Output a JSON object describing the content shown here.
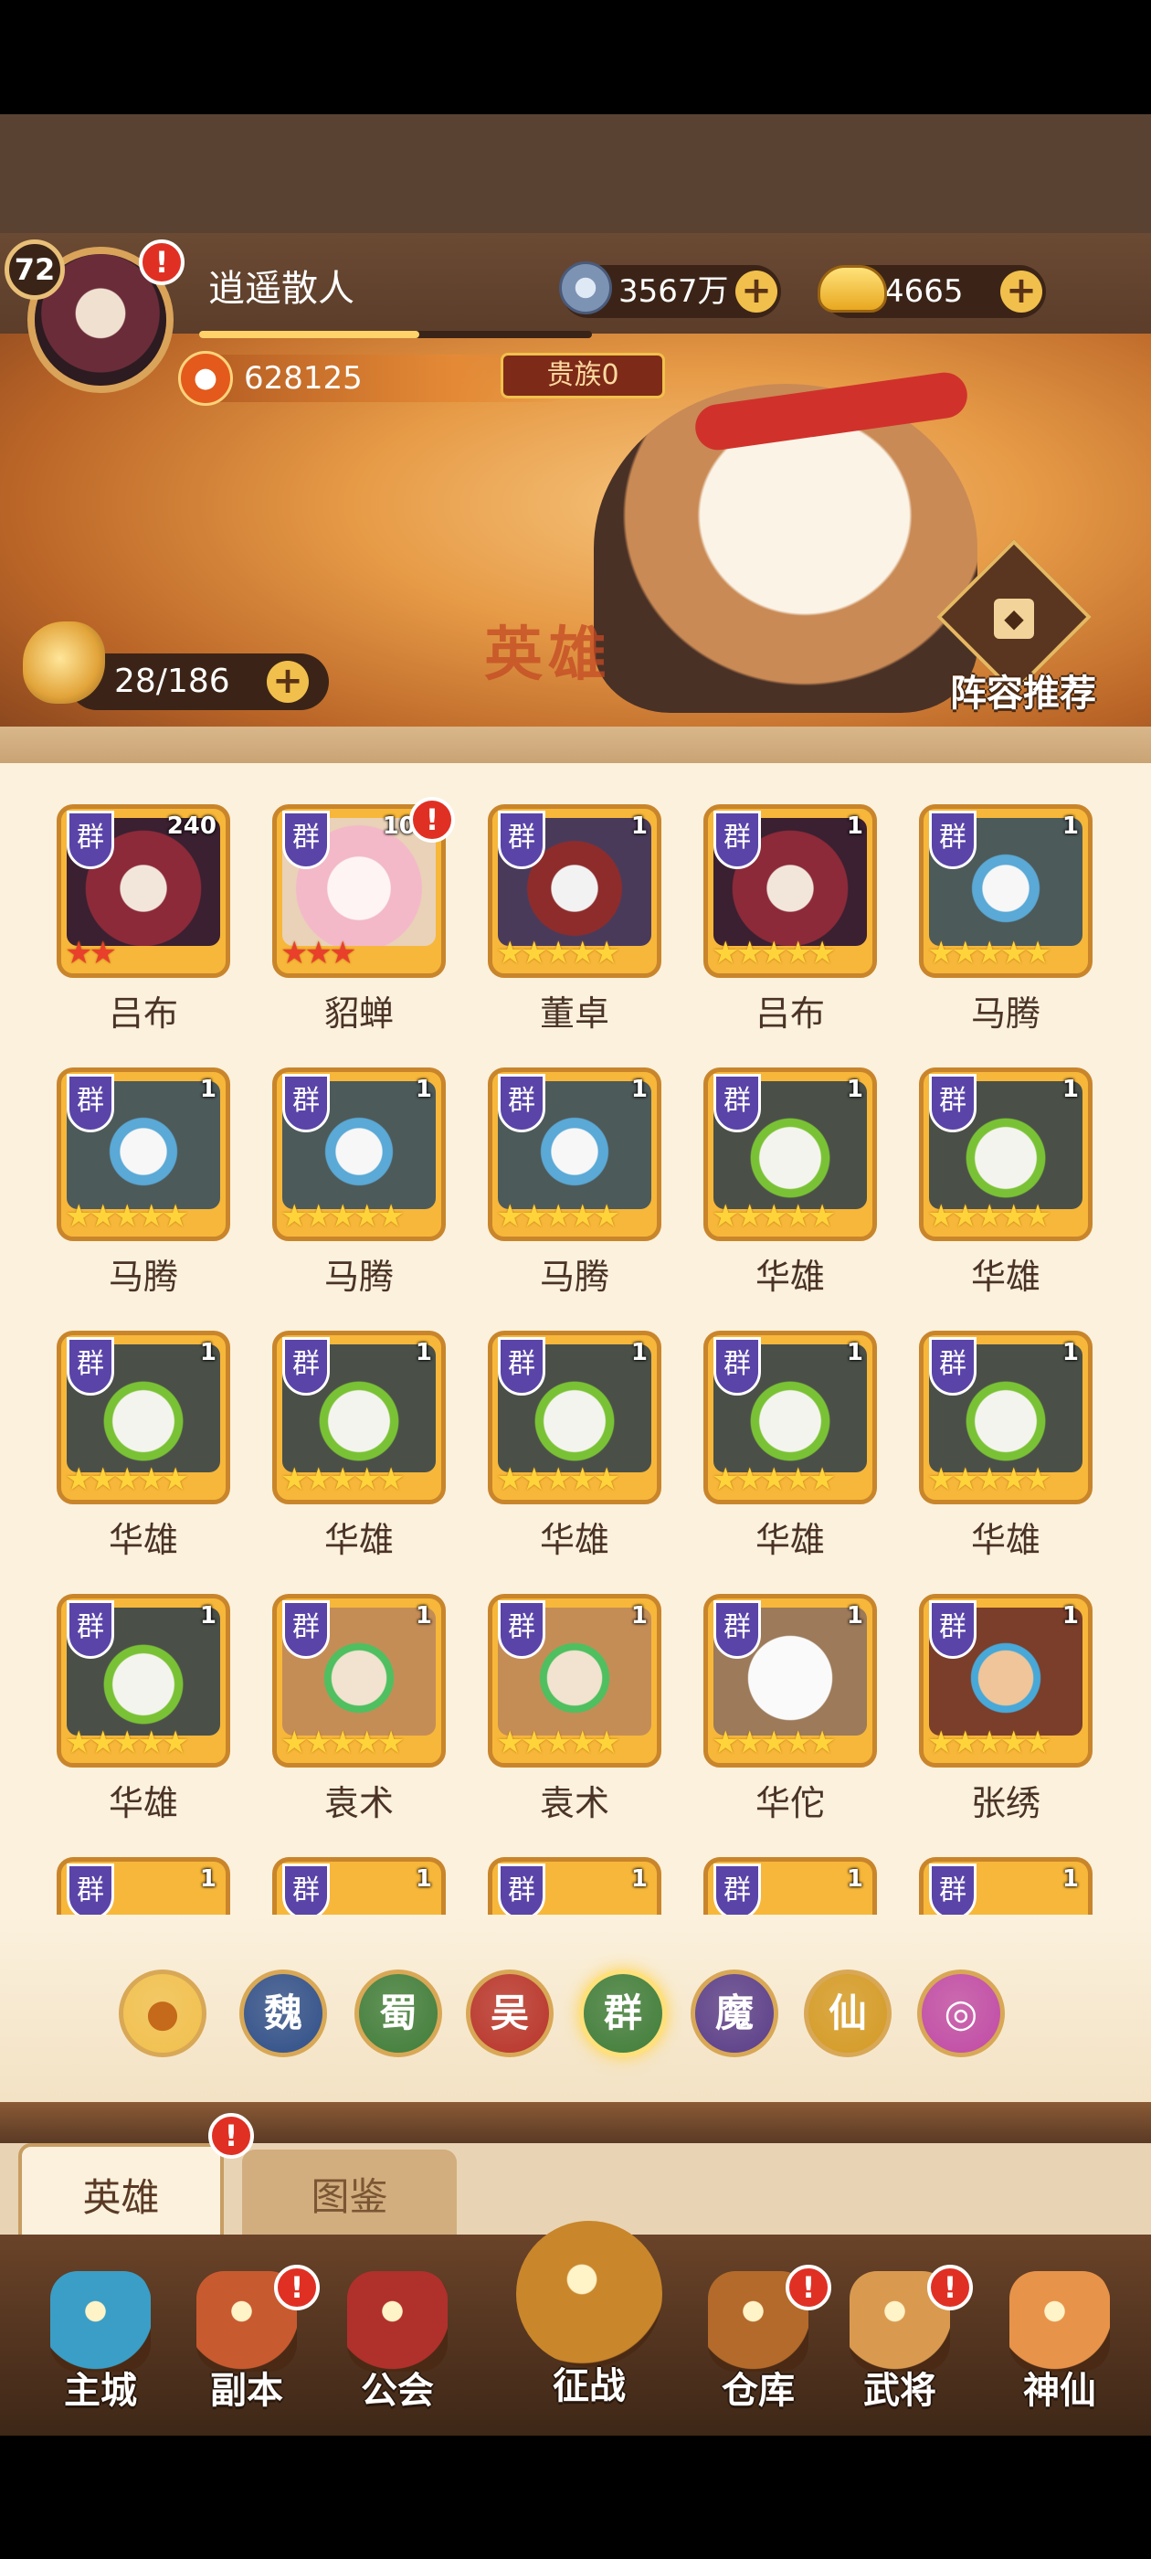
{
  "player": {
    "level": "72",
    "name": "逍遥散人",
    "exp_progress": 0.56,
    "power": "628125",
    "noble": "贵族0"
  },
  "currency": {
    "coins": "3567万",
    "ingots": "4665"
  },
  "banner": {
    "art_text": "英雄",
    "hero_count": "28/186",
    "lineup_label": "阵容推荐"
  },
  "heroes": [
    {
      "name": "吕布",
      "count": "240",
      "faction": "群",
      "stars": 2,
      "star_color": "red",
      "alert": false
    },
    {
      "name": "貂蝉",
      "count": "107",
      "faction": "群",
      "stars": 3,
      "star_color": "red",
      "alert": true
    },
    {
      "name": "董卓",
      "count": "1",
      "faction": "群",
      "stars": 5,
      "star_color": "gold",
      "alert": false
    },
    {
      "name": "吕布",
      "count": "1",
      "faction": "群",
      "stars": 5,
      "star_color": "gold",
      "alert": false
    },
    {
      "name": "马腾",
      "count": "1",
      "faction": "群",
      "stars": 5,
      "star_color": "gold",
      "alert": false
    },
    {
      "name": "马腾",
      "count": "1",
      "faction": "群",
      "stars": 5,
      "star_color": "gold",
      "alert": false
    },
    {
      "name": "马腾",
      "count": "1",
      "faction": "群",
      "stars": 5,
      "star_color": "gold",
      "alert": false
    },
    {
      "name": "马腾",
      "count": "1",
      "faction": "群",
      "stars": 5,
      "star_color": "gold",
      "alert": false
    },
    {
      "name": "华雄",
      "count": "1",
      "faction": "群",
      "stars": 5,
      "star_color": "gold",
      "alert": false
    },
    {
      "name": "华雄",
      "count": "1",
      "faction": "群",
      "stars": 5,
      "star_color": "gold",
      "alert": false
    },
    {
      "name": "华雄",
      "count": "1",
      "faction": "群",
      "stars": 5,
      "star_color": "gold",
      "alert": false
    },
    {
      "name": "华雄",
      "count": "1",
      "faction": "群",
      "stars": 5,
      "star_color": "gold",
      "alert": false
    },
    {
      "name": "华雄",
      "count": "1",
      "faction": "群",
      "stars": 5,
      "star_color": "gold",
      "alert": false
    },
    {
      "name": "华雄",
      "count": "1",
      "faction": "群",
      "stars": 5,
      "star_color": "gold",
      "alert": false
    },
    {
      "name": "华雄",
      "count": "1",
      "faction": "群",
      "stars": 5,
      "star_color": "gold",
      "alert": false
    },
    {
      "name": "华雄",
      "count": "1",
      "faction": "群",
      "stars": 5,
      "star_color": "gold",
      "alert": false
    },
    {
      "name": "袁术",
      "count": "1",
      "faction": "群",
      "stars": 5,
      "star_color": "gold",
      "alert": false
    },
    {
      "name": "袁术",
      "count": "1",
      "faction": "群",
      "stars": 5,
      "star_color": "gold",
      "alert": false
    },
    {
      "name": "华佗",
      "count": "1",
      "faction": "群",
      "stars": 5,
      "star_color": "gold",
      "alert": false
    },
    {
      "name": "张绣",
      "count": "1",
      "faction": "群",
      "stars": 5,
      "star_color": "gold",
      "alert": false
    }
  ],
  "partial_row": [
    {
      "faction": "群",
      "count": "1"
    },
    {
      "faction": "群",
      "count": "1"
    },
    {
      "faction": "群",
      "count": "1"
    },
    {
      "faction": "群",
      "count": "1"
    },
    {
      "faction": "群",
      "count": "1"
    }
  ],
  "filters": [
    {
      "label": "",
      "icon": "paw-icon",
      "color": "#f1c04c"
    },
    {
      "label": "魏",
      "icon": "",
      "color": "#2f4f8a"
    },
    {
      "label": "蜀",
      "icon": "",
      "color": "#3f7d3a"
    },
    {
      "label": "吴",
      "icon": "",
      "color": "#b8332a"
    },
    {
      "label": "群",
      "icon": "",
      "color": "#3f7d3a"
    },
    {
      "label": "魔",
      "icon": "",
      "color": "#5a3d8a"
    },
    {
      "label": "仙",
      "icon": "",
      "color": "#d49a24"
    },
    {
      "label": "",
      "icon": "spiral-icon",
      "color": "#c04aa6"
    }
  ],
  "tabs": [
    {
      "label": "英雄",
      "active": true
    },
    {
      "label": "图鉴",
      "active": false
    }
  ],
  "nav": [
    {
      "label": "主城",
      "color": "#3a9ec6"
    },
    {
      "label": "副本",
      "color": "#c85a30"
    },
    {
      "label": "公会",
      "color": "#b0302c"
    },
    {
      "label": "征战",
      "color": "#c9862b"
    },
    {
      "label": "仓库",
      "color": "#b36a2a"
    },
    {
      "label": "武将",
      "color": "#d99a50"
    },
    {
      "label": "神仙",
      "color": "#e8934a"
    }
  ]
}
